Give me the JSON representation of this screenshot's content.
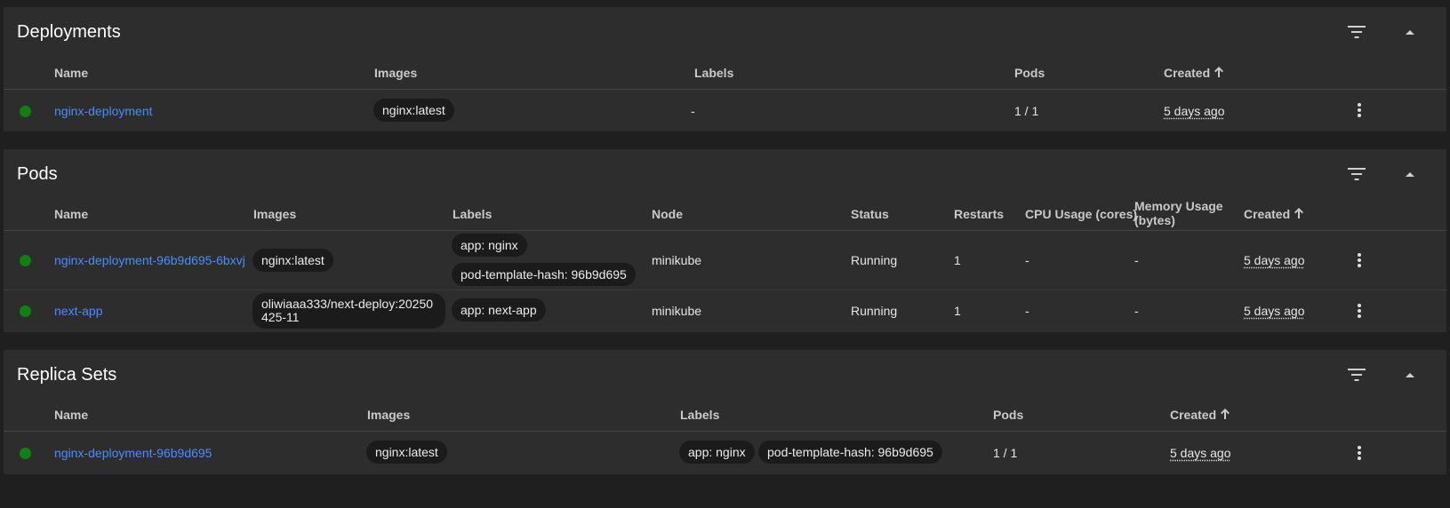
{
  "deployments": {
    "title": "Deployments",
    "columns": {
      "name": "Name",
      "images": "Images",
      "labels": "Labels",
      "pods": "Pods",
      "created": "Created"
    },
    "rows": [
      {
        "name": "nginx-deployment",
        "image": "nginx:latest",
        "labels": "-",
        "pods": "1 / 1",
        "created": "5 days ago"
      }
    ]
  },
  "pods": {
    "title": "Pods",
    "columns": {
      "name": "Name",
      "images": "Images",
      "labels": "Labels",
      "node": "Node",
      "status": "Status",
      "restarts": "Restarts",
      "cpu": "CPU Usage (cores)",
      "memory": "Memory Usage (bytes)",
      "created": "Created"
    },
    "rows": [
      {
        "name": "nginx-deployment-96b9d695-6bxvj",
        "image": "nginx:latest",
        "labels": [
          "app: nginx",
          "pod-template-hash: 96b9d695"
        ],
        "node": "minikube",
        "status": "Running",
        "restarts": "1",
        "cpu": "-",
        "memory": "-",
        "created": "5 days ago"
      },
      {
        "name": "next-app",
        "image": "oliwiaaa333/next-deploy:20250425-11",
        "labels": [
          "app: next-app"
        ],
        "node": "minikube",
        "status": "Running",
        "restarts": "1",
        "cpu": "-",
        "memory": "-",
        "created": "5 days ago"
      }
    ]
  },
  "replica_sets": {
    "title": "Replica Sets",
    "columns": {
      "name": "Name",
      "images": "Images",
      "labels": "Labels",
      "pods": "Pods",
      "created": "Created"
    },
    "rows": [
      {
        "name": "nginx-deployment-96b9d695",
        "image": "nginx:latest",
        "labels": [
          "app: nginx",
          "pod-template-hash: 96b9d695"
        ],
        "pods": "1 / 1",
        "created": "5 days ago"
      }
    ]
  },
  "icons": {
    "filter": "filter-list-icon",
    "collapse": "expand-less-icon",
    "sort": "arrow-upward-icon",
    "menu": "more-vert-icon",
    "status": "status-running-dot"
  },
  "colors": {
    "background": "#1f1f1f",
    "card": "#2d2d2d",
    "link": "#4a8cff",
    "status_ok": "#108010",
    "chip": "#1b1b1b"
  }
}
